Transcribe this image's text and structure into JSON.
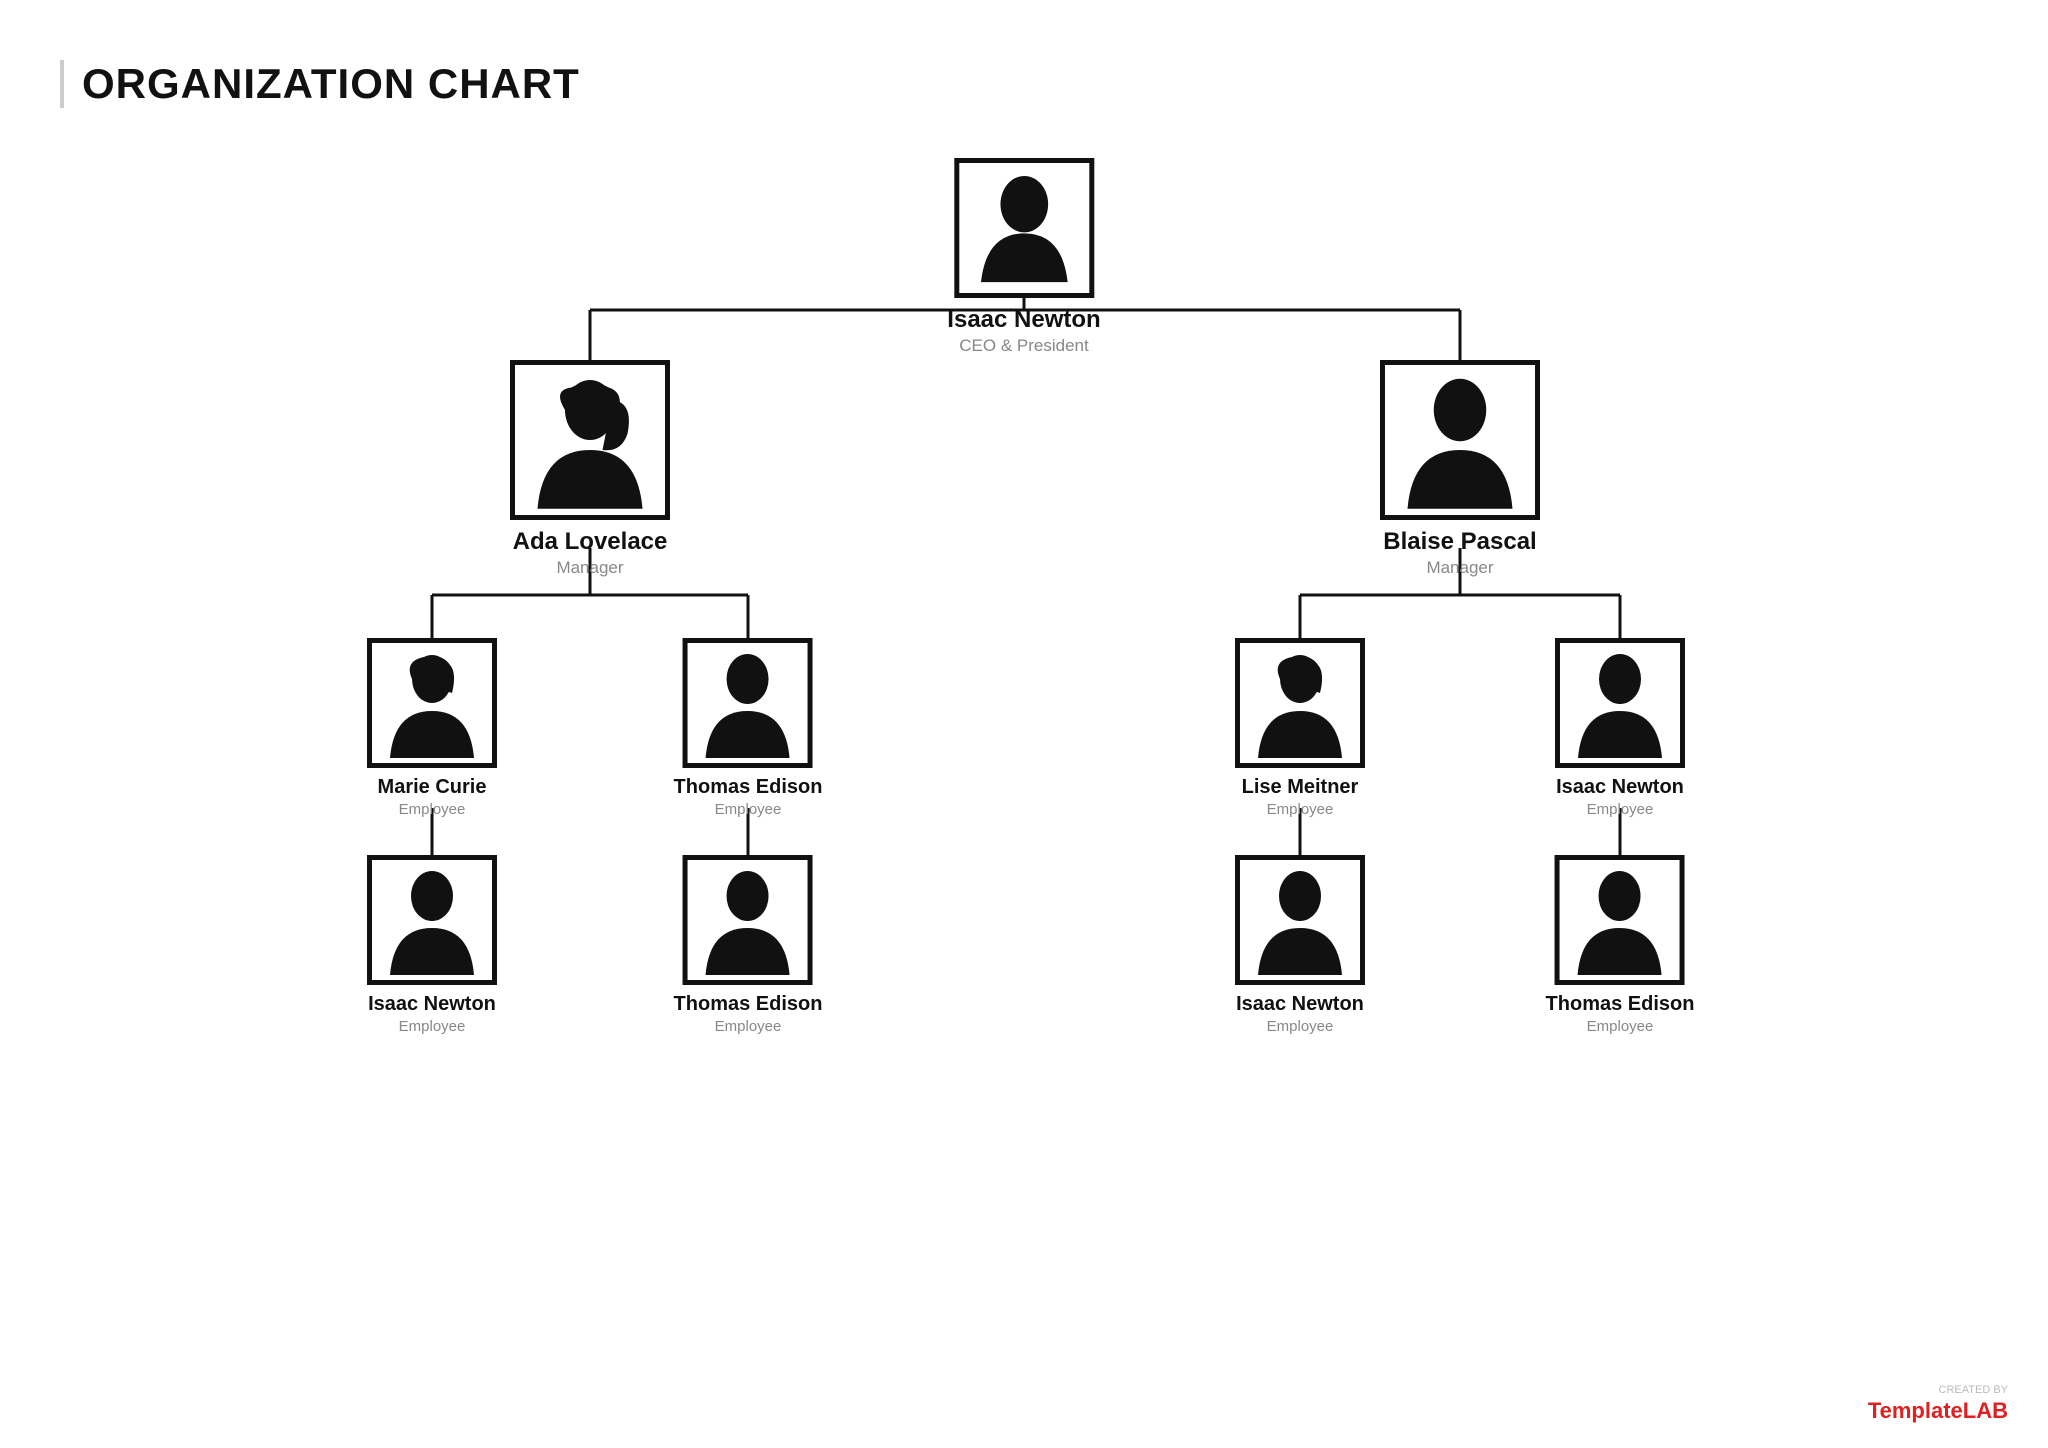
{
  "title": "ORGANIZATION CHART",
  "nodes": {
    "ceo": {
      "name": "Isaac Newton",
      "role": "CEO & President"
    },
    "mgr1": {
      "name": "Ada Lovelace",
      "role": "Manager"
    },
    "mgr2": {
      "name": "Blaise Pascal",
      "role": "Manager"
    },
    "emp1": {
      "name": "Marie Curie",
      "role": "Employee"
    },
    "emp2": {
      "name": "Thomas Edison",
      "role": "Employee"
    },
    "emp3": {
      "name": "Lise Meitner",
      "role": "Employee"
    },
    "emp4": {
      "name": "Isaac Newton",
      "role": "Employee"
    },
    "emp5": {
      "name": "Isaac Newton",
      "role": "Employee"
    },
    "emp6": {
      "name": "Thomas Edison",
      "role": "Employee"
    },
    "emp7": {
      "name": "Isaac Newton",
      "role": "Employee"
    },
    "emp8": {
      "name": "Thomas Edison",
      "role": "Employee"
    }
  },
  "badge": {
    "created_by": "CREATED BY",
    "brand_prefix": "Template",
    "brand_suffix": "LAB"
  }
}
